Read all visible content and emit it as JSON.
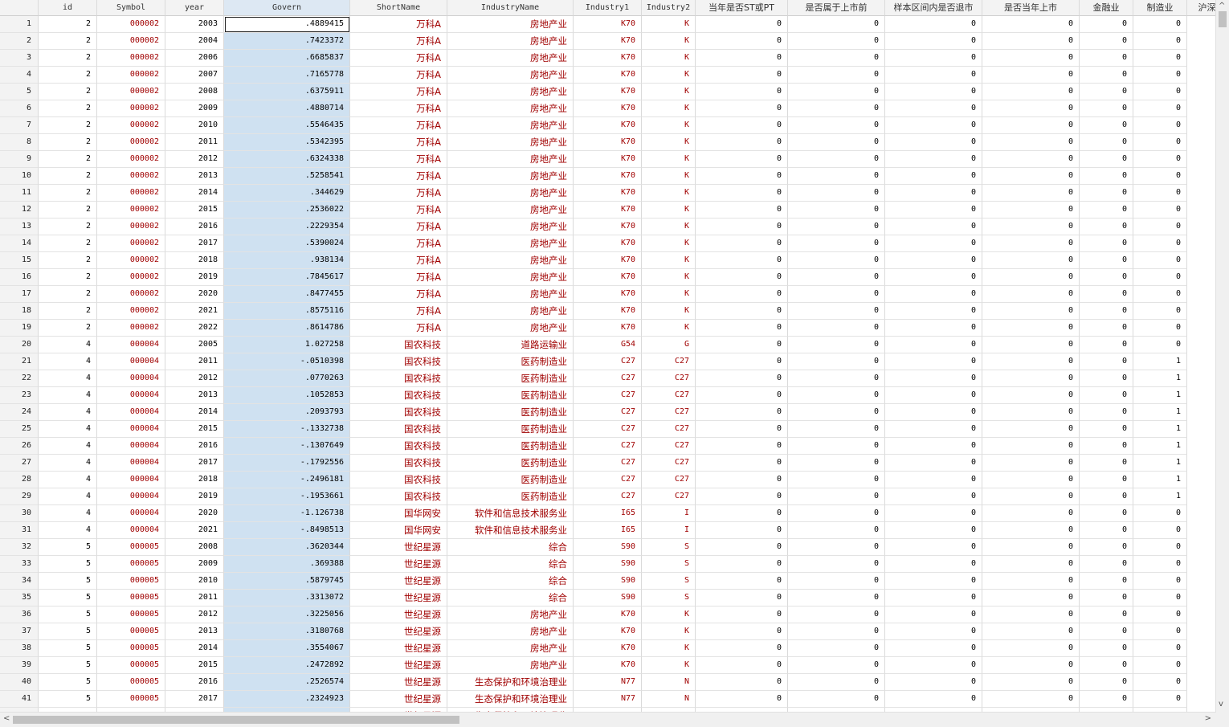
{
  "columns": [
    {
      "key": "rn",
      "label": ""
    },
    {
      "key": "id",
      "label": "id"
    },
    {
      "key": "symbol",
      "label": "Symbol"
    },
    {
      "key": "year",
      "label": "year"
    },
    {
      "key": "govern",
      "label": "Govern"
    },
    {
      "key": "short",
      "label": "ShortName"
    },
    {
      "key": "industry",
      "label": "IndustryName"
    },
    {
      "key": "ind1",
      "label": "Industry1"
    },
    {
      "key": "ind2",
      "label": "Industry2"
    },
    {
      "key": "st",
      "label": "当年是否ST或PT"
    },
    {
      "key": "prelist",
      "label": "是否属于上市前"
    },
    {
      "key": "delist",
      "label": "样本区间内是否退市"
    },
    {
      "key": "listyear",
      "label": "是否当年上市"
    },
    {
      "key": "fin",
      "label": "金融业"
    },
    {
      "key": "mfg",
      "label": "制造业"
    },
    {
      "key": "hu",
      "label": "沪深"
    }
  ],
  "rows": [
    [
      "1",
      "2",
      "000002",
      "2003",
      ".4889415",
      "万科A",
      "房地产业",
      "K70",
      "K",
      "0",
      "0",
      "0",
      "0",
      "0",
      "0"
    ],
    [
      "2",
      "2",
      "000002",
      "2004",
      ".7423372",
      "万科A",
      "房地产业",
      "K70",
      "K",
      "0",
      "0",
      "0",
      "0",
      "0",
      "0"
    ],
    [
      "3",
      "2",
      "000002",
      "2006",
      ".6685837",
      "万科A",
      "房地产业",
      "K70",
      "K",
      "0",
      "0",
      "0",
      "0",
      "0",
      "0"
    ],
    [
      "4",
      "2",
      "000002",
      "2007",
      ".7165778",
      "万科A",
      "房地产业",
      "K70",
      "K",
      "0",
      "0",
      "0",
      "0",
      "0",
      "0"
    ],
    [
      "5",
      "2",
      "000002",
      "2008",
      ".6375911",
      "万科A",
      "房地产业",
      "K70",
      "K",
      "0",
      "0",
      "0",
      "0",
      "0",
      "0"
    ],
    [
      "6",
      "2",
      "000002",
      "2009",
      ".4880714",
      "万科A",
      "房地产业",
      "K70",
      "K",
      "0",
      "0",
      "0",
      "0",
      "0",
      "0"
    ],
    [
      "7",
      "2",
      "000002",
      "2010",
      ".5546435",
      "万科A",
      "房地产业",
      "K70",
      "K",
      "0",
      "0",
      "0",
      "0",
      "0",
      "0"
    ],
    [
      "8",
      "2",
      "000002",
      "2011",
      ".5342395",
      "万科A",
      "房地产业",
      "K70",
      "K",
      "0",
      "0",
      "0",
      "0",
      "0",
      "0"
    ],
    [
      "9",
      "2",
      "000002",
      "2012",
      ".6324338",
      "万科A",
      "房地产业",
      "K70",
      "K",
      "0",
      "0",
      "0",
      "0",
      "0",
      "0"
    ],
    [
      "10",
      "2",
      "000002",
      "2013",
      ".5258541",
      "万科A",
      "房地产业",
      "K70",
      "K",
      "0",
      "0",
      "0",
      "0",
      "0",
      "0"
    ],
    [
      "11",
      "2",
      "000002",
      "2014",
      ".344629",
      "万科A",
      "房地产业",
      "K70",
      "K",
      "0",
      "0",
      "0",
      "0",
      "0",
      "0"
    ],
    [
      "12",
      "2",
      "000002",
      "2015",
      ".2536022",
      "万科A",
      "房地产业",
      "K70",
      "K",
      "0",
      "0",
      "0",
      "0",
      "0",
      "0"
    ],
    [
      "13",
      "2",
      "000002",
      "2016",
      ".2229354",
      "万科A",
      "房地产业",
      "K70",
      "K",
      "0",
      "0",
      "0",
      "0",
      "0",
      "0"
    ],
    [
      "14",
      "2",
      "000002",
      "2017",
      ".5390024",
      "万科A",
      "房地产业",
      "K70",
      "K",
      "0",
      "0",
      "0",
      "0",
      "0",
      "0"
    ],
    [
      "15",
      "2",
      "000002",
      "2018",
      ".938134",
      "万科A",
      "房地产业",
      "K70",
      "K",
      "0",
      "0",
      "0",
      "0",
      "0",
      "0"
    ],
    [
      "16",
      "2",
      "000002",
      "2019",
      ".7845617",
      "万科A",
      "房地产业",
      "K70",
      "K",
      "0",
      "0",
      "0",
      "0",
      "0",
      "0"
    ],
    [
      "17",
      "2",
      "000002",
      "2020",
      ".8477455",
      "万科A",
      "房地产业",
      "K70",
      "K",
      "0",
      "0",
      "0",
      "0",
      "0",
      "0"
    ],
    [
      "18",
      "2",
      "000002",
      "2021",
      ".8575116",
      "万科A",
      "房地产业",
      "K70",
      "K",
      "0",
      "0",
      "0",
      "0",
      "0",
      "0"
    ],
    [
      "19",
      "2",
      "000002",
      "2022",
      ".8614786",
      "万科A",
      "房地产业",
      "K70",
      "K",
      "0",
      "0",
      "0",
      "0",
      "0",
      "0"
    ],
    [
      "20",
      "4",
      "000004",
      "2005",
      "1.027258",
      "国农科技",
      "道路运输业",
      "G54",
      "G",
      "0",
      "0",
      "0",
      "0",
      "0",
      "0"
    ],
    [
      "21",
      "4",
      "000004",
      "2011",
      "-.0510398",
      "国农科技",
      "医药制造业",
      "C27",
      "C27",
      "0",
      "0",
      "0",
      "0",
      "0",
      "1"
    ],
    [
      "22",
      "4",
      "000004",
      "2012",
      ".0770263",
      "国农科技",
      "医药制造业",
      "C27",
      "C27",
      "0",
      "0",
      "0",
      "0",
      "0",
      "1"
    ],
    [
      "23",
      "4",
      "000004",
      "2013",
      ".1052853",
      "国农科技",
      "医药制造业",
      "C27",
      "C27",
      "0",
      "0",
      "0",
      "0",
      "0",
      "1"
    ],
    [
      "24",
      "4",
      "000004",
      "2014",
      ".2093793",
      "国农科技",
      "医药制造业",
      "C27",
      "C27",
      "0",
      "0",
      "0",
      "0",
      "0",
      "1"
    ],
    [
      "25",
      "4",
      "000004",
      "2015",
      "-.1332738",
      "国农科技",
      "医药制造业",
      "C27",
      "C27",
      "0",
      "0",
      "0",
      "0",
      "0",
      "1"
    ],
    [
      "26",
      "4",
      "000004",
      "2016",
      "-.1307649",
      "国农科技",
      "医药制造业",
      "C27",
      "C27",
      "0",
      "0",
      "0",
      "0",
      "0",
      "1"
    ],
    [
      "27",
      "4",
      "000004",
      "2017",
      "-.1792556",
      "国农科技",
      "医药制造业",
      "C27",
      "C27",
      "0",
      "0",
      "0",
      "0",
      "0",
      "1"
    ],
    [
      "28",
      "4",
      "000004",
      "2018",
      "-.2496181",
      "国农科技",
      "医药制造业",
      "C27",
      "C27",
      "0",
      "0",
      "0",
      "0",
      "0",
      "1"
    ],
    [
      "29",
      "4",
      "000004",
      "2019",
      "-.1953661",
      "国农科技",
      "医药制造业",
      "C27",
      "C27",
      "0",
      "0",
      "0",
      "0",
      "0",
      "1"
    ],
    [
      "30",
      "4",
      "000004",
      "2020",
      "-1.126738",
      "国华网安",
      "软件和信息技术服务业",
      "I65",
      "I",
      "0",
      "0",
      "0",
      "0",
      "0",
      "0"
    ],
    [
      "31",
      "4",
      "000004",
      "2021",
      "-.8498513",
      "国华网安",
      "软件和信息技术服务业",
      "I65",
      "I",
      "0",
      "0",
      "0",
      "0",
      "0",
      "0"
    ],
    [
      "32",
      "5",
      "000005",
      "2008",
      ".3620344",
      "世纪星源",
      "综合",
      "S90",
      "S",
      "0",
      "0",
      "0",
      "0",
      "0",
      "0"
    ],
    [
      "33",
      "5",
      "000005",
      "2009",
      ".369388",
      "世纪星源",
      "综合",
      "S90",
      "S",
      "0",
      "0",
      "0",
      "0",
      "0",
      "0"
    ],
    [
      "34",
      "5",
      "000005",
      "2010",
      ".5879745",
      "世纪星源",
      "综合",
      "S90",
      "S",
      "0",
      "0",
      "0",
      "0",
      "0",
      "0"
    ],
    [
      "35",
      "5",
      "000005",
      "2011",
      ".3313072",
      "世纪星源",
      "综合",
      "S90",
      "S",
      "0",
      "0",
      "0",
      "0",
      "0",
      "0"
    ],
    [
      "36",
      "5",
      "000005",
      "2012",
      ".3225056",
      "世纪星源",
      "房地产业",
      "K70",
      "K",
      "0",
      "0",
      "0",
      "0",
      "0",
      "0"
    ],
    [
      "37",
      "5",
      "000005",
      "2013",
      ".3180768",
      "世纪星源",
      "房地产业",
      "K70",
      "K",
      "0",
      "0",
      "0",
      "0",
      "0",
      "0"
    ],
    [
      "38",
      "5",
      "000005",
      "2014",
      ".3554067",
      "世纪星源",
      "房地产业",
      "K70",
      "K",
      "0",
      "0",
      "0",
      "0",
      "0",
      "0"
    ],
    [
      "39",
      "5",
      "000005",
      "2015",
      ".2472892",
      "世纪星源",
      "房地产业",
      "K70",
      "K",
      "0",
      "0",
      "0",
      "0",
      "0",
      "0"
    ],
    [
      "40",
      "5",
      "000005",
      "2016",
      ".2526574",
      "世纪星源",
      "生态保护和环境治理业",
      "N77",
      "N",
      "0",
      "0",
      "0",
      "0",
      "0",
      "0"
    ],
    [
      "41",
      "5",
      "000005",
      "2017",
      ".2324923",
      "世纪星源",
      "生态保护和环境治理业",
      "N77",
      "N",
      "0",
      "0",
      "0",
      "0",
      "0",
      "0"
    ]
  ],
  "partial_row": [
    "",
    "",
    "",
    "",
    "",
    "世纪星源",
    "生态保护和环境治理业",
    "",
    "",
    "",
    "",
    "",
    "",
    "",
    ""
  ],
  "scroll": {
    "left_arrow": "<",
    "right_arrow": ">",
    "up_arrow": "^",
    "down_arrow": "v"
  },
  "colors": {
    "text_red": "#a00000",
    "selected_column": "#cfe1f1",
    "header_bg": "#f3f3f3"
  }
}
